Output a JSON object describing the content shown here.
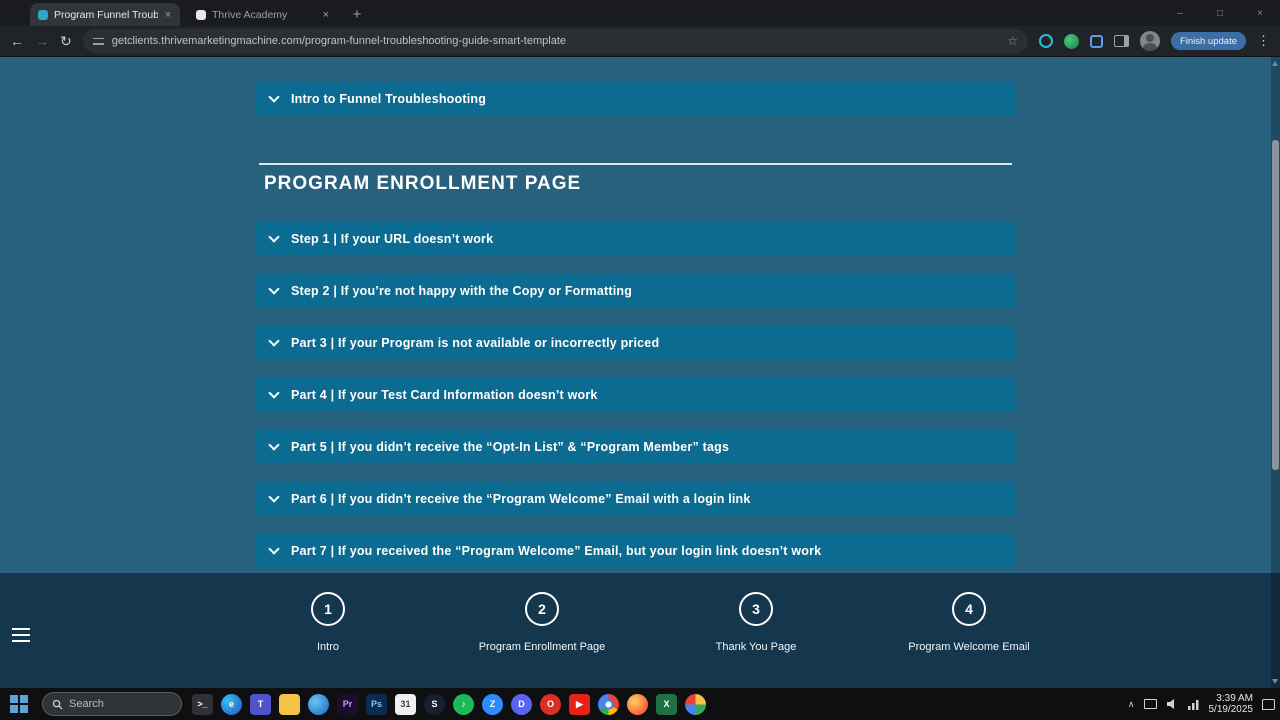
{
  "window": {
    "tabs": [
      {
        "title": "Program Funnel Troubleshooting"
      },
      {
        "title": "Thrive Academy"
      }
    ]
  },
  "icons": {
    "back": "←",
    "forward": "→",
    "reload": "↻",
    "bookmark_star": "☆",
    "kebab": "⋮",
    "new_tab": "+",
    "close_tab": "×",
    "minimize": "–",
    "maximize": "□",
    "close_window": "×",
    "tray_chevron": "∧"
  },
  "browser": {
    "url": "getclients.thrivemarketingmachine.com/program-funnel-troubleshooting-guide-smart-template",
    "update_button": "Finish update"
  },
  "colors": {
    "page_background": "#27617d",
    "accordion_background": "#0c6b90",
    "footer_background": "#15374d",
    "update_button": "#3b6ea5",
    "text": "#ffffff"
  },
  "page": {
    "intro_accordion": "Intro to Funnel Troubleshooting",
    "section_title": "PROGRAM ENROLLMENT PAGE",
    "accordions": [
      "Step 1 | If your URL doesn’t work",
      "Step 2 | If you’re not happy with the Copy or Formatting",
      "Part 3 | If your Program is not available or incorrectly priced",
      "Part 4 | If your Test Card Information doesn’t work",
      "Part 5 | If you didn’t receive the “Opt-In List” & “Program Member” tags",
      "Part 6 | If you didn’t receive the “Program Welcome” Email with a login link",
      "Part 7 | If you received the “Program Welcome” Email, but your login link doesn’t work"
    ]
  },
  "footer": {
    "steps": [
      {
        "number": "1",
        "label": "Intro"
      },
      {
        "number": "2",
        "label": "Program Enrollment Page"
      },
      {
        "number": "3",
        "label": "Thank You Page"
      },
      {
        "number": "4",
        "label": "Program Welcome Email"
      }
    ]
  },
  "taskbar": {
    "search_placeholder": "Search",
    "time": "3:39 AM",
    "date": "5/19/2025",
    "icons": [
      {
        "name": "terminal-icon",
        "color": "#2f3136",
        "glyph": ">_"
      },
      {
        "name": "edge-icon",
        "color": "radial-gradient(circle at 32% 32%, #35c1f1, #2052cb)",
        "glyph": "e",
        "shape": "circle"
      },
      {
        "name": "teams-icon",
        "color": "#4e54c8",
        "glyph": "T"
      },
      {
        "name": "file-explorer-icon",
        "color": "#f5c344",
        "glyph": "",
        "fg": "#a87b1e"
      },
      {
        "name": "browser-blue-icon",
        "color": "radial-gradient(circle at 35% 35%, #6cc6f0, #1766c2)",
        "glyph": "",
        "shape": "circle"
      },
      {
        "name": "premiere-icon",
        "color": "#1a0d2e",
        "glyph": "Pr",
        "fg": "#c79bff"
      },
      {
        "name": "photoshop-icon",
        "color": "#0d2b4e",
        "glyph": "Ps",
        "fg": "#7fc4ff"
      },
      {
        "name": "calendar-icon",
        "color": "#f0f0f0",
        "glyph": "31",
        "fg": "#444444"
      },
      {
        "name": "steam-icon",
        "color": "#17202e",
        "glyph": "S",
        "shape": "circle"
      },
      {
        "name": "spotify-icon",
        "color": "#1db954",
        "glyph": "♪",
        "shape": "circle"
      },
      {
        "name": "zoom-icon",
        "color": "#2d8cff",
        "glyph": "Z",
        "shape": "circle"
      },
      {
        "name": "discord-icon",
        "color": "#5865f2",
        "glyph": "D",
        "shape": "circle"
      },
      {
        "name": "app-red-icon",
        "color": "#d93025",
        "glyph": "O",
        "shape": "circle"
      },
      {
        "name": "youtube-icon",
        "color": "#e62117",
        "glyph": "▶"
      },
      {
        "name": "chrome-icon",
        "color": "radial-gradient(circle at 50% 50%, #ffffff 0 3px, #4285f4 3px 5px, rgba(0,0,0,0) 5px), conic-gradient(#ea4335 0 33%, #fbbc05 0 50%, #34a853 0 66%, #4285f4 0 100%)",
        "glyph": "",
        "shape": "circle"
      },
      {
        "name": "firefox-icon",
        "color": "radial-gradient(circle at 35% 35%, #ffd567, #ff7139 60%, #e3336b)",
        "glyph": "",
        "shape": "circle"
      },
      {
        "name": "excel-icon",
        "color": "#1e7145",
        "glyph": "X"
      },
      {
        "name": "app-colorful-icon",
        "color": "conic-gradient(#f6c344 0 25%, #3aa757 0 50%, #4285f4 0 75%, #ea4335 0 100%)",
        "glyph": "",
        "shape": "circle"
      }
    ]
  }
}
